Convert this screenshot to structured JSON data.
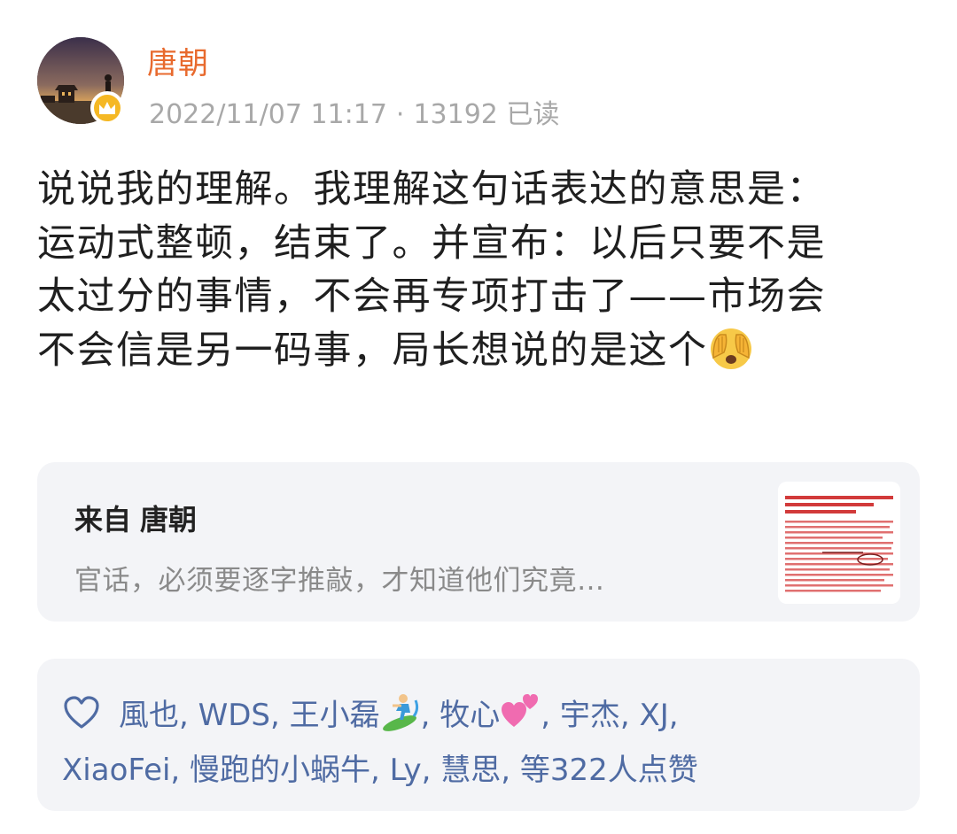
{
  "post": {
    "author": "唐朝",
    "date": "2022/11/07 11:17",
    "separator": "·",
    "reads": "13192 已读",
    "badge_icon": "crown-icon",
    "body_lines": [
      "说说我的理解。我理解这句话表达的意思是：",
      "运动式整顿，结束了。并宣布：以后只要不是",
      "太过分的事情，不会再专项打击了——市场会",
      "不会信是另一码事，局长想说的是这个"
    ],
    "body_emoji": "face-with-hands-over-eyes-emoji"
  },
  "source": {
    "from_label": "来自",
    "from_name": "唐朝",
    "snippet": "官话，必须要逐字推敲，才知道他们究竟…",
    "thumbnail_icon": "news-article-thumbnail"
  },
  "likes": {
    "icon": "heart-outline-icon",
    "line1_a": "風也, WDS, 王小磊",
    "line1_b": ", 牧心",
    "line1_c": ", 宇杰, XJ,",
    "line2": "XiaoFei, 慢跑的小蜗牛, Ly, 慧思, 等322人点赞",
    "emoji_1": "surfer-emoji",
    "emoji_2": "two-hearts-emoji",
    "accent_color": "#4f6ba3"
  },
  "colors": {
    "author": "#e86a2e",
    "meta": "#a8a8a8",
    "card_bg": "#f3f4f7",
    "badge": "#f5b824"
  }
}
